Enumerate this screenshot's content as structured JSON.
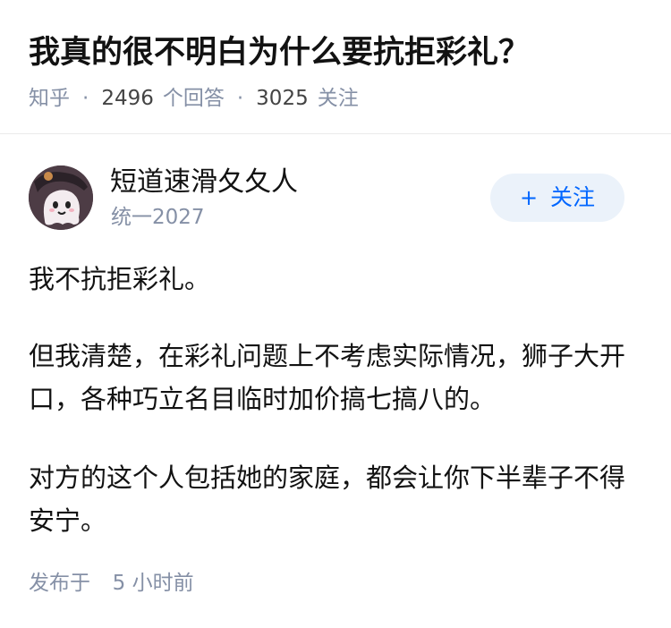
{
  "question": {
    "title": "我真的很不明白为什么要抗拒彩礼？",
    "source": "知乎",
    "answer_count": "2496",
    "answer_label": "个回答",
    "follow_count": "3025",
    "follow_label": "关注",
    "separator": "·"
  },
  "author": {
    "avatar_icon": "avatar-ghost-icon",
    "name": "短道速滑夂夂人",
    "badge": "统一2027",
    "follow_plus": "+",
    "follow_label": "关注"
  },
  "answer": {
    "paragraphs": [
      "我不抗拒彩礼。",
      "但我清楚，在彩礼问题上不考虑实际情况，狮子大开口，各种巧立名目临时加价搞七搞八的。",
      "对方的这个人包括她的家庭，都会让你下半辈子不得安宁。"
    ],
    "published_label": "发布于",
    "published_time": "5 小时前"
  },
  "colors": {
    "accent": "#0066ff",
    "follow_bg": "#ebf2fa",
    "meta_gray": "#8590a6",
    "text": "#121212"
  }
}
